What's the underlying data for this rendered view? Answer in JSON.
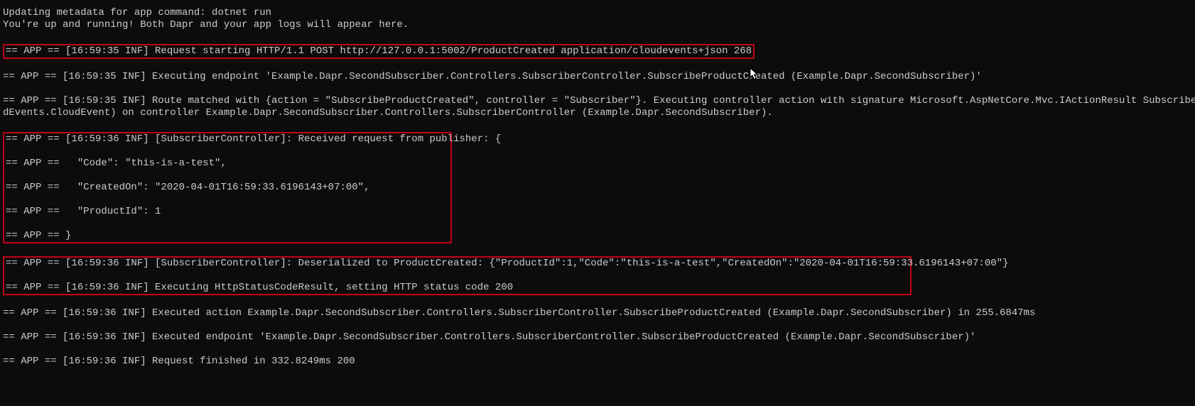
{
  "header": {
    "line1": "Updating metadata for app command: dotnet run",
    "line2": "You're up and running! Both Dapr and your app logs will appear here."
  },
  "box1": {
    "line1": "== APP == [16:59:35 INF] Request starting HTTP/1.1 POST http://127.0.0.1:5002/ProductCreated application/cloudevents+json 268"
  },
  "mid1": {
    "line1": "== APP == [16:59:35 INF] Executing endpoint 'Example.Dapr.SecondSubscriber.Controllers.SubscriberController.SubscribeProductCreated (Example.Dapr.SecondSubscriber)'"
  },
  "mid2": {
    "line1": "== APP == [16:59:35 INF] Route matched with {action = \"SubscribeProductCreated\", controller = \"Subscriber\"}. Executing controller action with signature Microsoft.AspNetCore.Mvc.IActionResult SubscribeProductCre",
    "line2": "dEvents.CloudEvent) on controller Example.Dapr.SecondSubscriber.Controllers.SubscriberController (Example.Dapr.SecondSubscriber)."
  },
  "box2": {
    "line1": "== APP == [16:59:36 INF] [SubscriberController]: Received request from publisher: {",
    "line2": "== APP ==   \"Code\": \"this-is-a-test\",",
    "line3": "== APP ==   \"CreatedOn\": \"2020-04-01T16:59:33.6196143+07:00\",",
    "line4": "== APP ==   \"ProductId\": 1",
    "line5": "== APP == }"
  },
  "box3": {
    "line1": "== APP == [16:59:36 INF] [SubscriberController]: Deserialized to ProductCreated: {\"ProductId\":1,\"Code\":\"this-is-a-test\",\"CreatedOn\":\"2020-04-01T16:59:33.6196143+07:00\"}",
    "line2": "== APP == [16:59:36 INF] Executing HttpStatusCodeResult, setting HTTP status code 200"
  },
  "footer": {
    "line1": "== APP == [16:59:36 INF] Executed action Example.Dapr.SecondSubscriber.Controllers.SubscriberController.SubscribeProductCreated (Example.Dapr.SecondSubscriber) in 255.6847ms",
    "line2": "== APP == [16:59:36 INF] Executed endpoint 'Example.Dapr.SecondSubscriber.Controllers.SubscriberController.SubscribeProductCreated (Example.Dapr.SecondSubscriber)'",
    "line3": "== APP == [16:59:36 INF] Request finished in 332.8249ms 200"
  }
}
